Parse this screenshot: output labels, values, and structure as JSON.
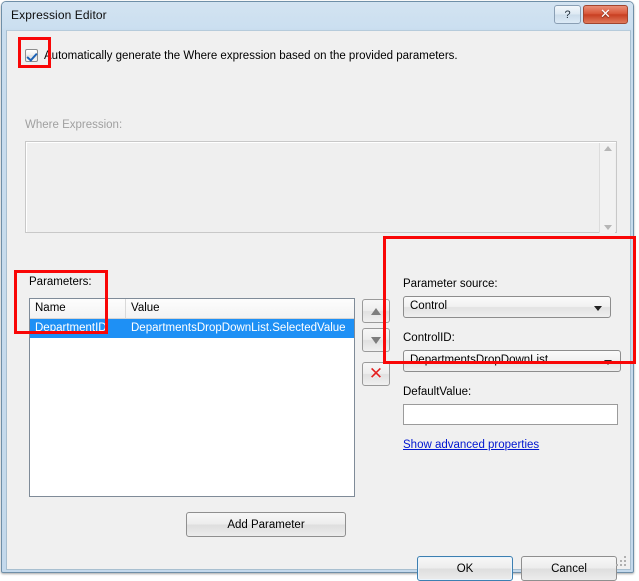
{
  "window": {
    "title": "Expression Editor",
    "help_button": "?",
    "close_button": "✕"
  },
  "auto_generate": {
    "label": "Automatically generate the Where expression based on the provided parameters.",
    "checked": true,
    "checkbox_icon": "checkbox-checked-icon"
  },
  "where_expression": {
    "label": "Where Expression:",
    "value": "",
    "enabled": false,
    "scrollbar": {
      "up_icon": "scroll-up-arrow-icon",
      "down_icon": "scroll-down-arrow-icon"
    }
  },
  "parameters": {
    "label": "Parameters:",
    "columns": [
      "Name",
      "Value"
    ],
    "rows": [
      {
        "name": "DepartmentID",
        "value": "DepartmentsDropDownList.SelectedValue",
        "selected": true
      }
    ],
    "add_button": "Add Parameter",
    "move_up_icon": "arrow-up-icon",
    "move_down_icon": "arrow-down-icon",
    "delete_icon": "red-x-delete-icon"
  },
  "parameter_panel": {
    "source_label": "Parameter source:",
    "source_value": "Control",
    "controlid_label": "ControlID:",
    "controlid_value": "DepartmentsDropDownList",
    "defaultvalue_label": "DefaultValue:",
    "defaultvalue_value": "",
    "advanced_link": "Show advanced properties",
    "dropdown_icon": "chevron-down-icon"
  },
  "footer": {
    "ok": "OK",
    "cancel": "Cancel",
    "resize_grip_icon": "resize-grip-icon"
  },
  "annotations": {
    "accent_color": "#f90606",
    "highlight_color": "#1e90f5",
    "boxes": [
      {
        "name": "checkbox-highlight"
      },
      {
        "name": "parameter-name-highlight"
      },
      {
        "name": "parameter-source-highlight"
      }
    ]
  }
}
